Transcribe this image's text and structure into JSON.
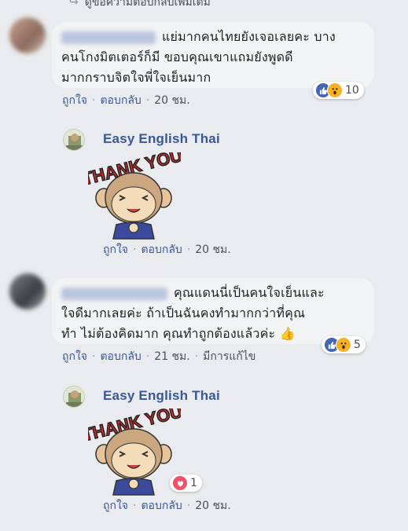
{
  "top_reply": {
    "label": "ดูข้อความตอบกลับเพิ่มเติม"
  },
  "comments": [
    {
      "text": "แย่มากคนไทยยังเจอเลยคะ บางคนโกงมิตเตอร์ก็มี ขอบคุณเขาแถมยังพูดดีมากกราบจิตใจพี่ใจเย็นมาก",
      "lines": [
        "แย่มากคนไทยยังเจอเลยคะ บาง",
        "คนโกงมิตเตอร์ก็มี ขอบคุณเขาแถมยังพูดดี",
        "มากกราบจิตใจพี่ใจเย็นมาก"
      ],
      "reactions": [
        "like-icon",
        "wow-icon"
      ],
      "reaction_count": "10",
      "actions": {
        "like": "ถูกใจ",
        "reply": "ตอบกลับ",
        "time": "20 ชม."
      }
    },
    {
      "lines": [
        "คุณแดนนี่เป็นคนใจเย็นและ",
        "ใจดีมากเลยค่ะ ถ้าเป็นฉันคงทำมากกว่าที่คุณ",
        "ทำ ไม่ต้องคิดมาก คุณทำถูกต้องแล้วค่ะ"
      ],
      "emoji": "👍",
      "reactions": [
        "like-icon",
        "wow-icon"
      ],
      "reaction_count": "5",
      "actions": {
        "like": "ถูกใจ",
        "reply": "ตอบกลับ",
        "time": "21 ชม.",
        "edited": "มีการแก้ไข"
      }
    }
  ],
  "page_replies": [
    {
      "page_name": "Easy English Thai",
      "sticker_text": "THANK YOU",
      "actions": {
        "like": "ถูกใจ",
        "reply": "ตอบกลับ",
        "time": "20 ชม."
      }
    },
    {
      "page_name": "Easy English Thai",
      "sticker_text": "THANK YOU",
      "reactions": [
        "love-icon"
      ],
      "reaction_count": "1",
      "actions": {
        "like": "ถูกใจ",
        "reply": "ตอบกลับ",
        "time": "20 ชม."
      }
    }
  ],
  "colors": {
    "link": "#385898",
    "bubble": "#f2f3f5",
    "background": "#e9ebee",
    "like": "#4267b2",
    "wow": "#f7b125",
    "love": "#f25268"
  }
}
